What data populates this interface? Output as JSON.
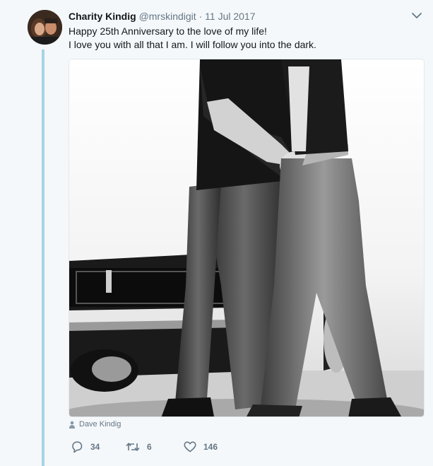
{
  "tweet": {
    "author_name": "Charity Kindig",
    "handle": "@mrskindigit",
    "separator": "·",
    "date": "11 Jul 2017",
    "lines": [
      "Happy 25th Anniversary to the love of my life!",
      "I love you with all that I am. I will follow you into the dark."
    ],
    "media_attribution": "Dave Kindig",
    "counts": {
      "replies": "34",
      "retweets": "6",
      "likes": "146"
    }
  },
  "icons": {
    "caret": "chevron-down-icon",
    "attribution": "person-icon",
    "reply": "reply-icon",
    "retweet": "retweet-icon",
    "like": "heart-icon"
  },
  "colors": {
    "thread_line": "#a8d4e6",
    "muted": "#657786",
    "text": "#14171a"
  }
}
